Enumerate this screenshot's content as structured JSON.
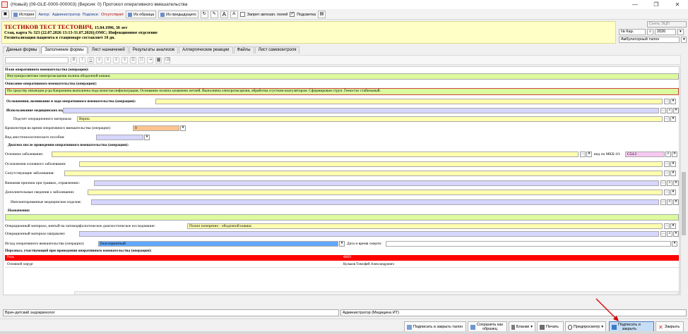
{
  "window": {
    "title": "(Новый) (09-GLE-0000-000003) (Версия: 0) Протокол оперативного вмешательства",
    "controls": [
      "—",
      "❐",
      "✕"
    ]
  },
  "toolbar": {
    "history_label": "История",
    "author_label": "Автор:",
    "author_value": "Администратор",
    "signatures_label": "Подписи:",
    "signatures_value": "Отсутствуют",
    "from_template_label": "Из образца",
    "from_previous_label": "Из предыдущего",
    "font_bigger": "A",
    "font_smaller": "A",
    "autofill_ban_label": "Запрет автозап. полей",
    "highlight_label": "Подсветка"
  },
  "patient": {
    "name": "ТЕСТИКОВ ТЕСТ ТЕСТОВИЧ,",
    "dob_age": "15.04.1996, 30 лет",
    "card_line": "Стац. карта № 323 (22.07.2026 13:13-31.07.2026);ОМС; Инфекционное отделение",
    "hosp_line": "Госпитализация пациента в стационаре составляет 10 дн."
  },
  "right_panel": {
    "remove_ecp_label": "Снять ЭЦП",
    "card_no_label": "№ Кар.",
    "year_value": "2026",
    "ticket_type": "Амбулаторный талон"
  },
  "tabs": [
    "Данные формы",
    "Заполнение формы",
    "Лист назначений",
    "Результаты анализов",
    "Аллергические реакции",
    "Файлы",
    "Лист самоконтроля"
  ],
  "active_tab": 1,
  "form": {
    "plan_label": "План оперативного вмешательства (операции):",
    "plan_value": "Внутрипросветная электроэксцизия полипа ободочной кишки.",
    "description_label": "Описание оперативного вмешательства (операции):",
    "description_value": "По средству инъекции р-ра Капромина выполнена подслизистая инфильтрация. Основание полипа захвачено петлей. Выполнена электроэксцизия, обработка сгустком коагулятором. Сформирован струп. Гемостаз стабильный.",
    "complications_label": "Осложнения, возникшие в ходе оперативного вмешательства (операции):",
    "devices_label": "Использование медицинских изделий:",
    "material_count_label": "Подсчет операционного материала:",
    "material_count_value": "Верно.",
    "blood_loss_label": "Кровопотеря во время оперативного вмешательства (операции):",
    "blood_loss_value": "0",
    "anesthesia_label": "Вид анестезиологического пособия:",
    "diagnosis_header": "Диагноз после проведения оперативного вмешательства (операции):",
    "main_disease_label": "Основное заболевание:",
    "mkb_label": "вид по МКБ-10:",
    "mkb_value": "C54.2",
    "main_complications_label": "Осложнения основного заболевания:",
    "concomitant_label": "Сопутствующие заболевания:",
    "external_cause_label": "Внешняя причина при травмах, отравлениях:",
    "additional_info_label": "Дополнительные сведения о заболевании:",
    "implanted_label": "Имплантированные медицинские изделия:",
    "prescriptions_label": "Назначения:",
    "pathomorph_label": "Операционный материал, взятый на патоморфологическое диагностическое исследование:",
    "pathomorph_value": "Полип поперечно - ободочной кишки.",
    "material_sent_label": "Операционный материал направлен:",
    "outcome_label": "Исход оперативного вмешательства (операции):",
    "outcome_value": "благоприятный",
    "death_date_label": "Дата и время смерти:",
    "staff_label": "Персонал, участвующий при проведении оперативного вмешательства (операции):"
  },
  "staff_table": {
    "columns": [
      "Роль",
      "ФИО"
    ],
    "rows": [
      [
        "Основной хирург",
        "Кульков Тимофей Александрович"
      ]
    ]
  },
  "footer_fields": {
    "specialty": "Врач-детский эндокринолог",
    "user": "Администратор (Медицина ИТ)"
  },
  "actions": {
    "sign_close_ticket": "Подписать и закрыть талон",
    "save_as_template_1": "Сохранить как",
    "save_as_template_2": "образец",
    "blanks": "Бланки",
    "print": "Печать",
    "preview": "Предпросмотр",
    "sign_close_1": "Подписать и",
    "sign_close_2": "закрыть",
    "close": "Закрыть"
  }
}
